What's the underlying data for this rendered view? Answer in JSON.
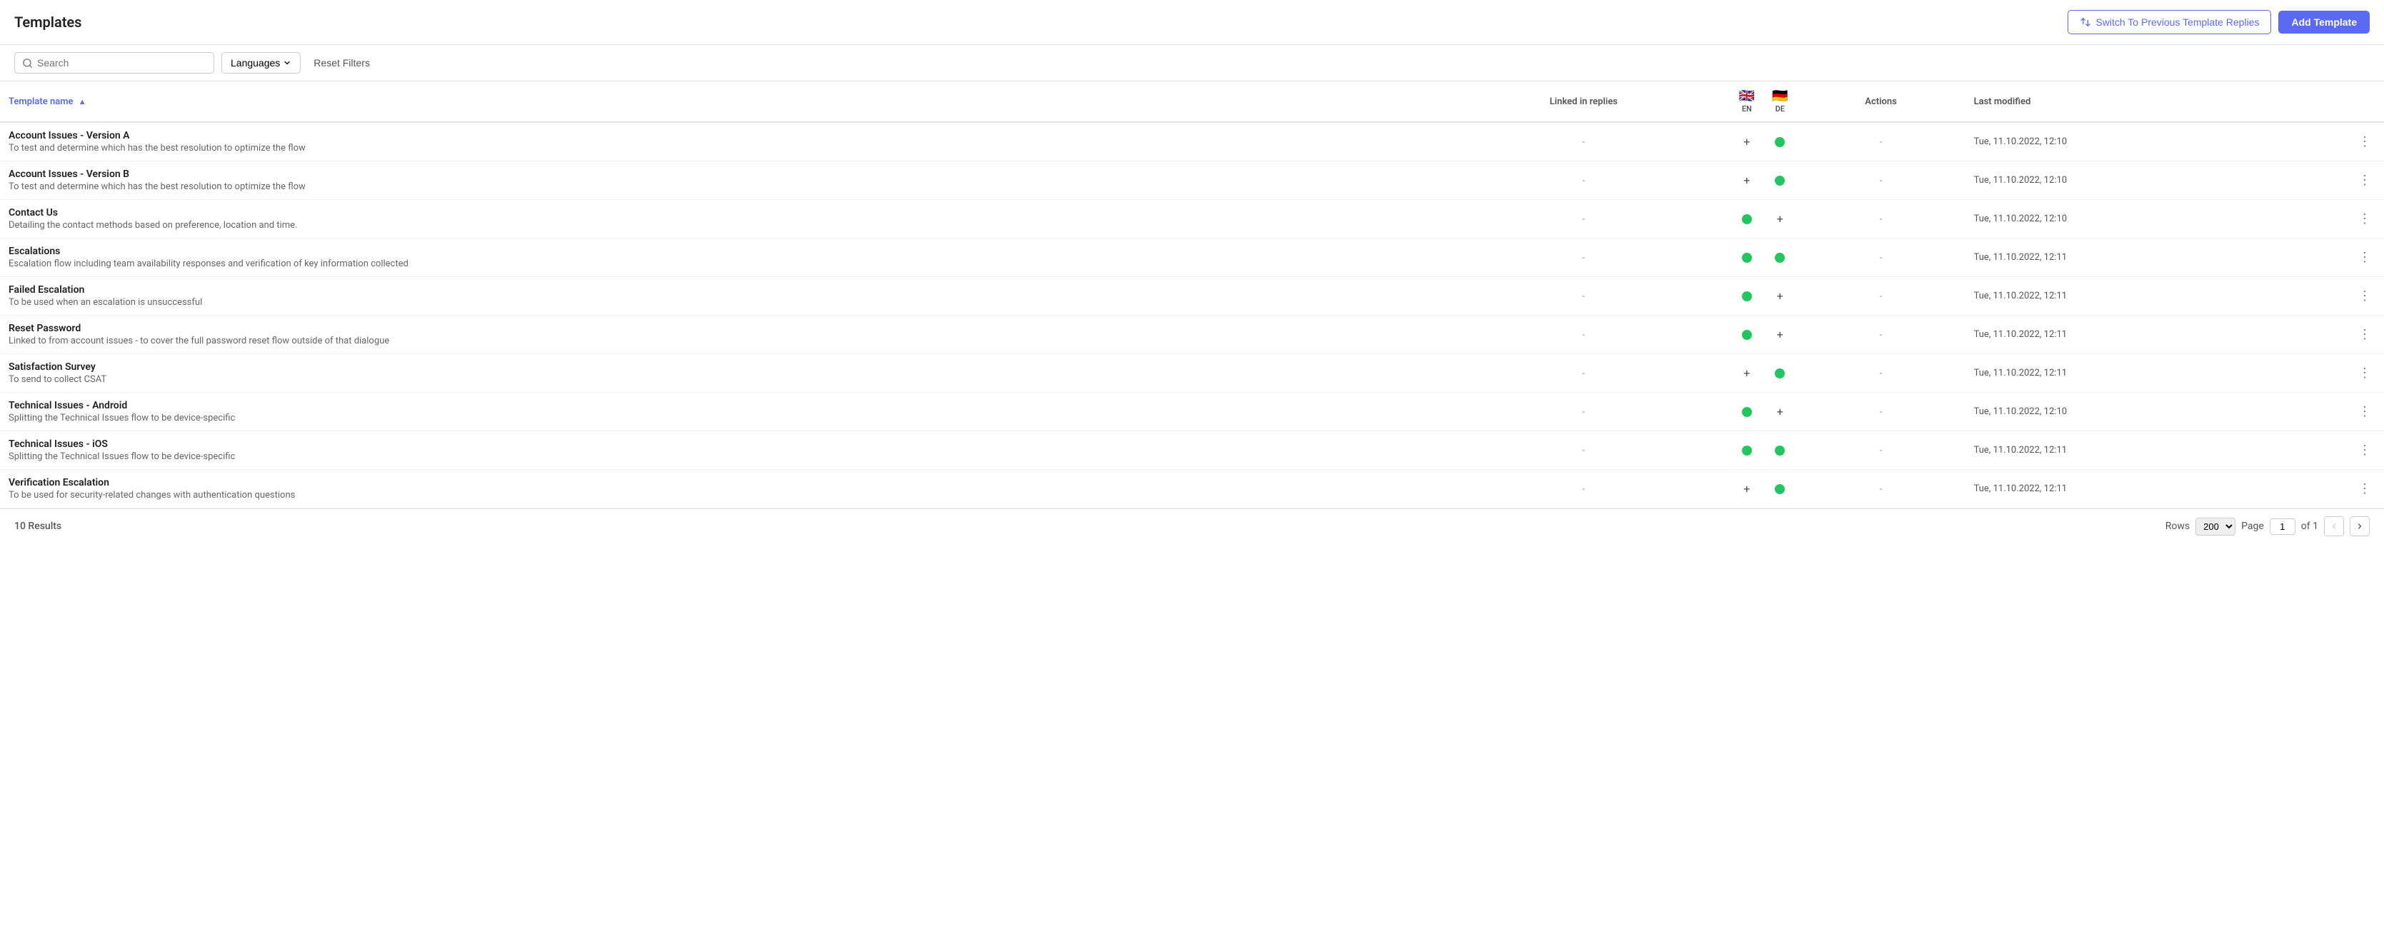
{
  "page": {
    "title": "Templates"
  },
  "header": {
    "switch_button_label": "Switch To Previous Template Replies",
    "add_button_label": "Add Template"
  },
  "filters": {
    "search_placeholder": "Search",
    "languages_label": "Languages",
    "reset_label": "Reset Filters"
  },
  "table": {
    "columns": {
      "template_name": "Template name",
      "linked_in_replies": "Linked in replies",
      "en": "EN",
      "de": "DE",
      "actions": "Actions",
      "last_modified": "Last modified"
    },
    "rows": [
      {
        "name": "Account Issues - Version A",
        "desc": "To test and determine which has the best resolution to optimize the flow",
        "linked": "-",
        "en_has_dot": false,
        "de_has_dot": true,
        "actions": "-",
        "modified": "Tue, 11.10.2022, 12:10"
      },
      {
        "name": "Account Issues - Version B",
        "desc": "To test and determine which has the best resolution to optimize the flow",
        "linked": "-",
        "en_has_dot": false,
        "de_has_dot": true,
        "actions": "-",
        "modified": "Tue, 11.10.2022, 12:10"
      },
      {
        "name": "Contact Us",
        "desc": "Detailing the contact methods based on preference, location and time.",
        "linked": "-",
        "en_has_dot": true,
        "de_has_dot": false,
        "actions": "-",
        "modified": "Tue, 11.10.2022, 12:10"
      },
      {
        "name": "Escalations",
        "desc": "Escalation flow including team availability responses and verification of key information collected",
        "linked": "-",
        "en_has_dot": true,
        "de_has_dot": true,
        "actions": "-",
        "modified": "Tue, 11.10.2022, 12:11"
      },
      {
        "name": "Failed Escalation",
        "desc": "To be used when an escalation is unsuccessful",
        "linked": "-",
        "en_has_dot": true,
        "de_has_dot": false,
        "actions": "-",
        "modified": "Tue, 11.10.2022, 12:11"
      },
      {
        "name": "Reset Password",
        "desc": "Linked to from account issues - to cover the full password reset flow outside of that dialogue",
        "linked": "-",
        "en_has_dot": true,
        "de_has_dot": false,
        "actions": "-",
        "modified": "Tue, 11.10.2022, 12:11"
      },
      {
        "name": "Satisfaction Survey",
        "desc": "To send to collect CSAT",
        "linked": "-",
        "en_has_dot": false,
        "de_has_dot": true,
        "actions": "-",
        "modified": "Tue, 11.10.2022, 12:11"
      },
      {
        "name": "Technical Issues - Android",
        "desc": "Splitting the Technical Issues flow to be device-specific",
        "linked": "-",
        "en_has_dot": true,
        "de_has_dot": false,
        "actions": "-",
        "modified": "Tue, 11.10.2022, 12:10"
      },
      {
        "name": "Technical Issues - iOS",
        "desc": "Splitting the Technical Issues flow to be device-specific",
        "linked": "-",
        "en_has_dot": true,
        "de_has_dot": true,
        "actions": "-",
        "modified": "Tue, 11.10.2022, 12:11"
      },
      {
        "name": "Verification Escalation",
        "desc": "To be used for security-related changes with authentication questions",
        "linked": "-",
        "en_has_dot": false,
        "de_has_dot": true,
        "actions": "-",
        "modified": "Tue, 11.10.2022, 12:11"
      }
    ]
  },
  "footer": {
    "results_label": "10 Results",
    "rows_label": "Rows",
    "rows_value": "200",
    "page_label": "Page",
    "page_value": "1",
    "of_label": "of 1"
  }
}
